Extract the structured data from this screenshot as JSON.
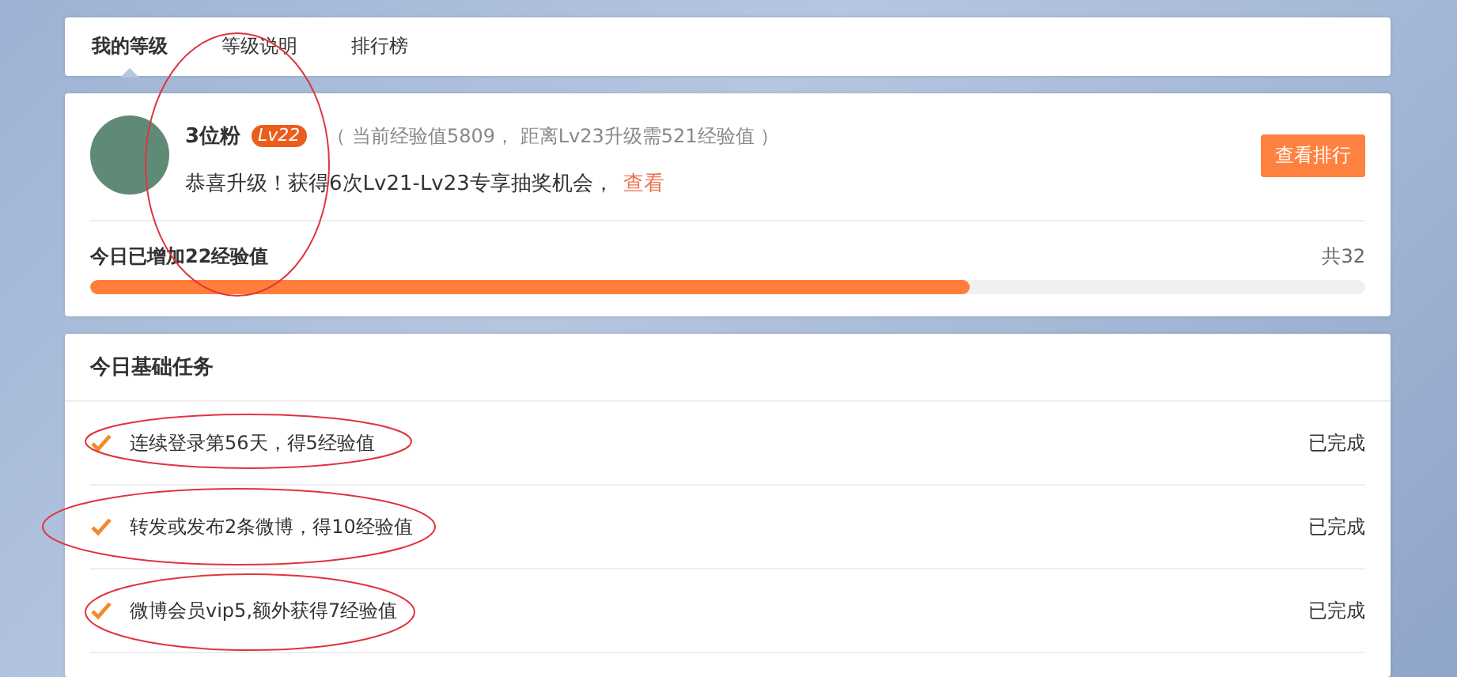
{
  "tabs": [
    {
      "label": "我的等级",
      "selected": true
    },
    {
      "label": "等级说明",
      "selected": false
    },
    {
      "label": "排行榜",
      "selected": false
    }
  ],
  "profile": {
    "name": "3位粉",
    "level_badge": "Lv22",
    "exp_note": "（ 当前经验值5809， 距离Lv23升级需521经验值 ）",
    "message": "恭喜升级！获得6次Lv21-Lv23专享抽奖机会，",
    "message_link": "查看",
    "button": "查看排行"
  },
  "today": {
    "label": "今日已增加22经验值",
    "total": "共32",
    "level": 0.69
  },
  "tasks": {
    "title": "今日基础任务",
    "items": [
      {
        "text": "连续登录第56天，得5经验值",
        "done": true,
        "status": "已完成"
      },
      {
        "text": "转发或发布2条微博，得10经验值",
        "done": true,
        "status": "已完成"
      },
      {
        "text": "微博会员vip5,额外获得7经验值",
        "done": true,
        "status": "已完成"
      }
    ]
  }
}
